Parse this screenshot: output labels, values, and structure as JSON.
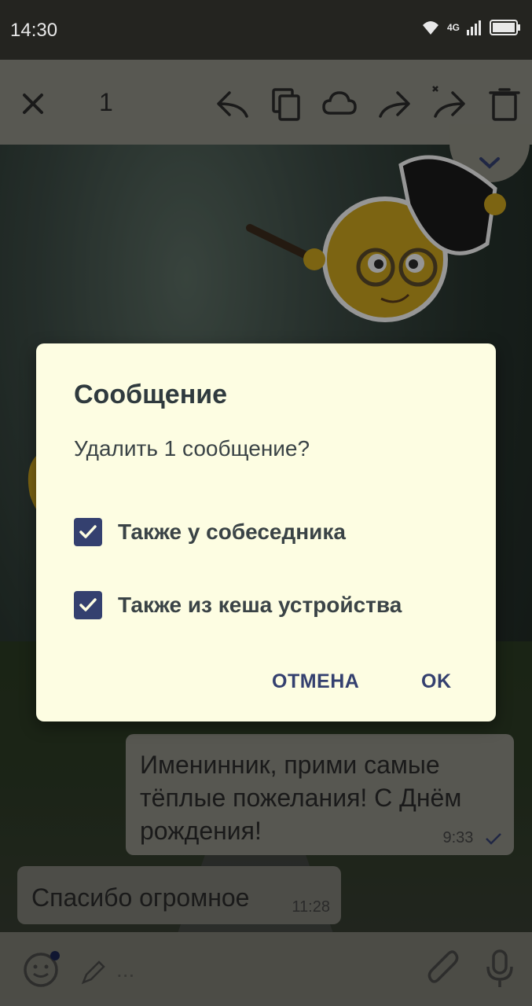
{
  "status_bar": {
    "time": "14:30",
    "network": "4G"
  },
  "action_bar": {
    "selected_count": "1"
  },
  "dialog": {
    "title": "Сообщение",
    "message": "Удалить 1 сообщение?",
    "options": [
      {
        "label": "Также у собеседника",
        "checked": true
      },
      {
        "label": "Также из кеша устройства",
        "checked": true
      }
    ],
    "cancel_label": "ОТМЕНА",
    "ok_label": "OK"
  },
  "messages": {
    "outgoing": {
      "text": "Именинник, прими самые тёплые пожелания! С Днём рождения!",
      "time": "9:33"
    },
    "incoming": {
      "text": "Спасибо огромное",
      "time": "11:28"
    }
  },
  "input": {
    "placeholder": "..."
  },
  "colors": {
    "accent": "#34406f",
    "dialog_bg": "#fdfde2"
  }
}
